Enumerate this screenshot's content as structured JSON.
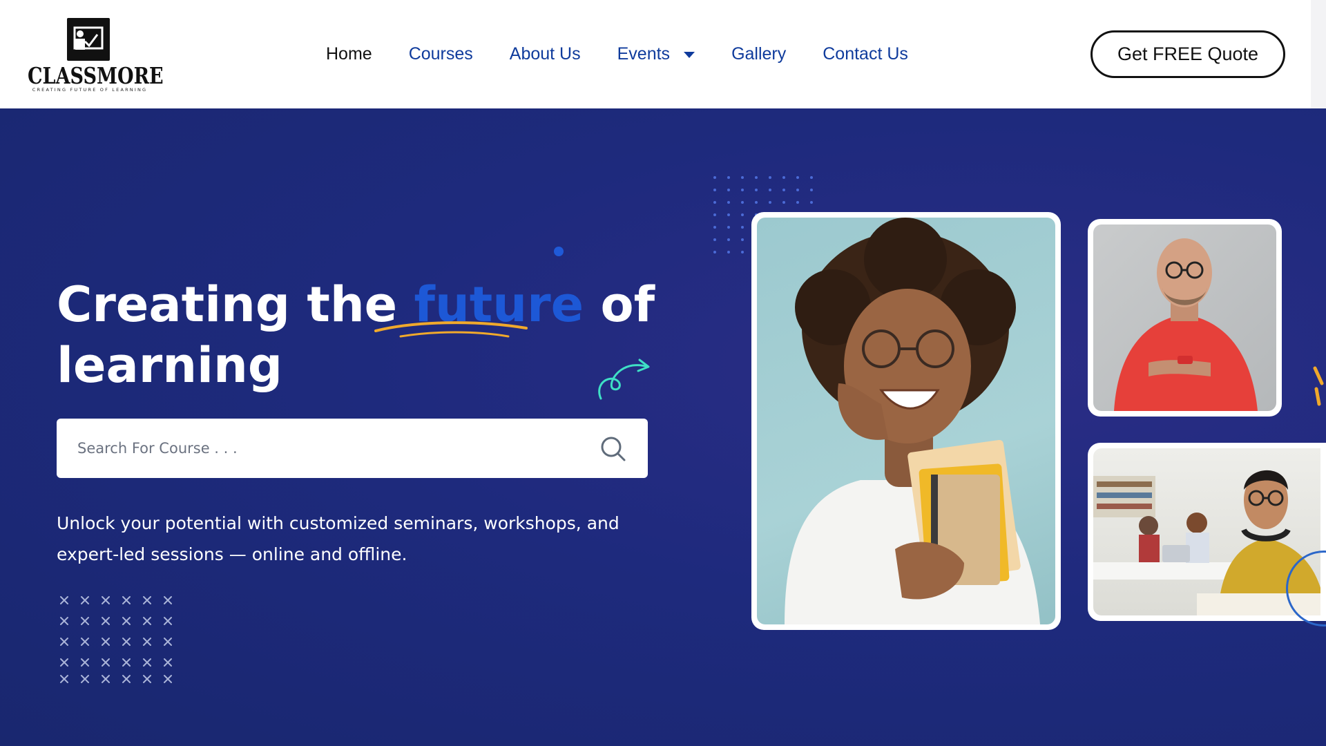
{
  "brand": {
    "name": "CLASSMORE",
    "tagline": "CREATING FUTURE OF LEARNING"
  },
  "nav": {
    "items": [
      {
        "label": "Home",
        "active": true
      },
      {
        "label": "Courses"
      },
      {
        "label": "About Us"
      },
      {
        "label": "Events",
        "has_dropdown": true
      },
      {
        "label": "Gallery"
      },
      {
        "label": "Contact Us"
      }
    ]
  },
  "cta": {
    "quote_label": "Get FREE Quote"
  },
  "hero": {
    "headline_part1": "Creating the ",
    "headline_highlight": "future",
    "headline_part2": " of",
    "headline_line2": "learning",
    "search_placeholder": "Search For Course . . .",
    "description": "Unlock your potential with customized seminars, workshops, and expert-led sessions — online and offline."
  },
  "colors": {
    "hero_bg": "#1e2a7d",
    "accent_blue": "#1d58d6",
    "nav_blue": "#0f3b9c",
    "underline_yellow": "#f0a92c",
    "arrow_teal": "#3fe0c5"
  },
  "icons": {
    "logo": "presentation-board-icon",
    "search": "search-icon",
    "dropdown": "caret-down-icon",
    "arrow": "curly-arrow-icon"
  },
  "images": {
    "main": "student-woman-with-books",
    "top_right": "man-with-phone",
    "bottom_right": "students-in-classroom"
  }
}
